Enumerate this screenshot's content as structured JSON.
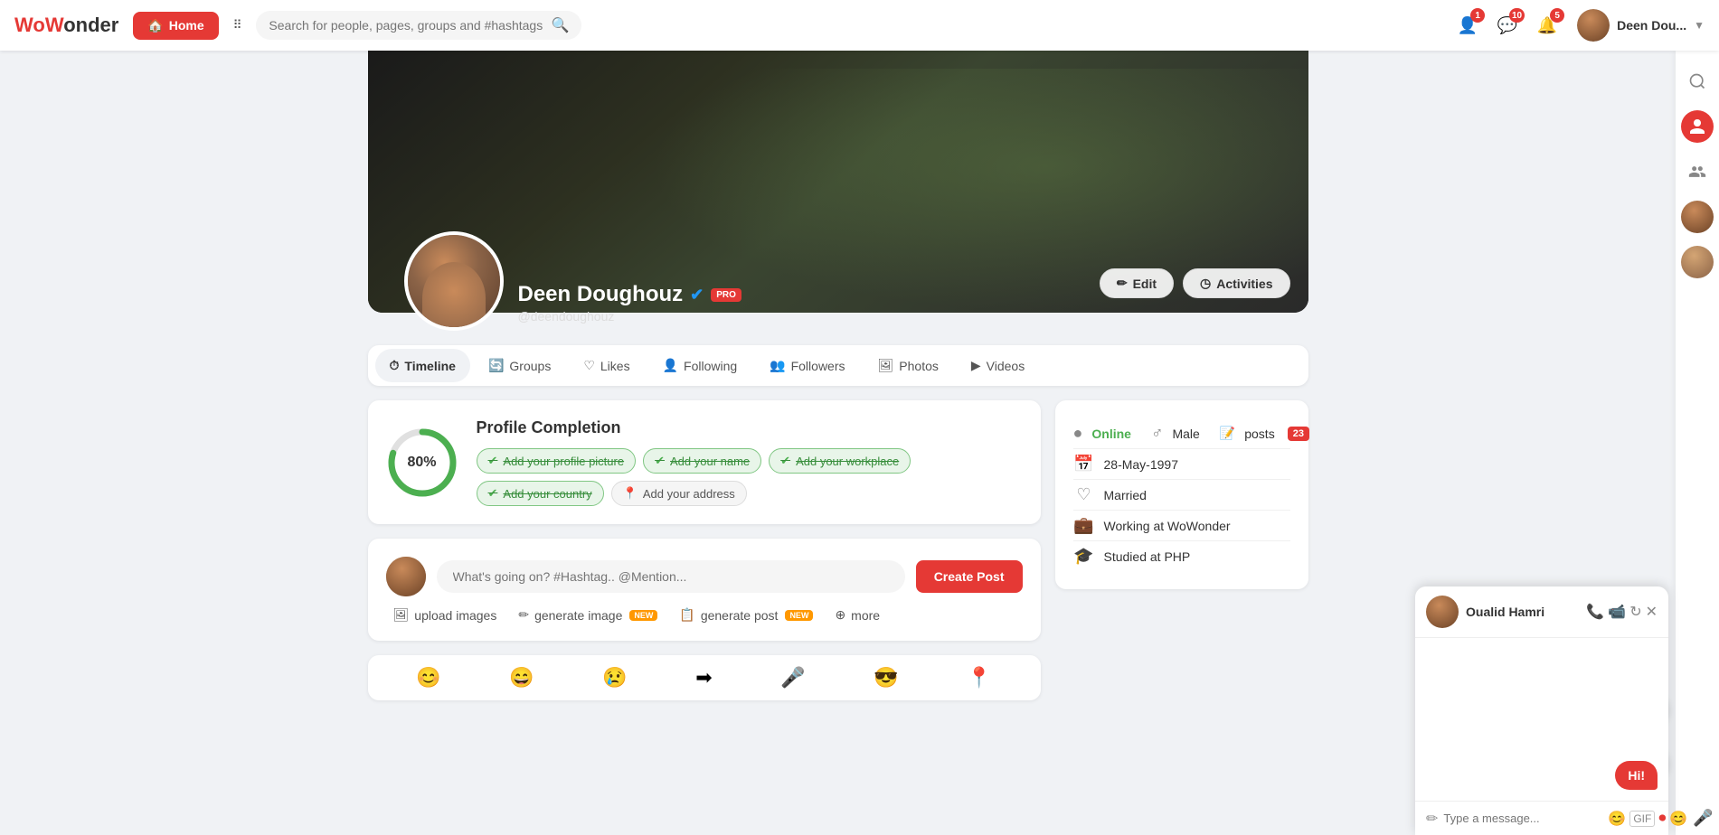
{
  "app": {
    "logo_text": "WoWonder"
  },
  "navbar": {
    "home_label": "Home",
    "search_placeholder": "Search for people, pages, groups and #hashtags",
    "badge_friends": "1",
    "badge_messages": "10",
    "badge_notifications": "5",
    "user_name": "Deen Dou..."
  },
  "profile": {
    "name": "Deen Doughouz",
    "handle": "@deendoughouz",
    "verified": true,
    "pro": "PRO",
    "edit_label": "Edit",
    "activities_label": "Activities"
  },
  "tabs": [
    {
      "id": "timeline",
      "label": "Timeline",
      "icon": "⏱"
    },
    {
      "id": "groups",
      "label": "Groups",
      "icon": "🔄"
    },
    {
      "id": "likes",
      "label": "Likes",
      "icon": "♡"
    },
    {
      "id": "following",
      "label": "Following",
      "icon": "👤"
    },
    {
      "id": "followers",
      "label": "Followers",
      "icon": "👥"
    },
    {
      "id": "photos",
      "label": "Photos",
      "icon": "🖼"
    },
    {
      "id": "videos",
      "label": "Videos",
      "icon": "▶"
    }
  ],
  "completion": {
    "title": "Profile Completion",
    "percent": "80%",
    "percent_num": 80,
    "tags": [
      {
        "label": "Add your profile picture",
        "done": true
      },
      {
        "label": "Add your name",
        "done": true
      },
      {
        "label": "Add your workplace",
        "done": true
      },
      {
        "label": "Add your country",
        "done": true
      },
      {
        "label": "Add your address",
        "done": false
      }
    ]
  },
  "post_box": {
    "placeholder": "What's going on? #Hashtag.. @Mention...",
    "create_btn": "Create Post",
    "actions": [
      {
        "id": "upload",
        "label": "upload images",
        "icon": "🖼",
        "new": false
      },
      {
        "id": "generate_image",
        "label": "generate image",
        "icon": "✏",
        "new": true
      },
      {
        "id": "generate_post",
        "label": "generate post",
        "icon": "📋",
        "new": true
      },
      {
        "id": "more",
        "label": "more",
        "icon": "⊕",
        "new": false
      }
    ]
  },
  "emoji_bar": {
    "emojis": [
      "😊",
      "😄",
      "😢",
      "➡",
      "🎤",
      "😎",
      "📍"
    ]
  },
  "user_info": {
    "status": "Online",
    "gender": "Male",
    "posts_label": "posts",
    "posts_count": "23",
    "birthday": "28-May-1997",
    "relationship": "Married",
    "work": "Working at WoWonder",
    "education": "Studied at PHP"
  },
  "chat": {
    "contact_name": "Oualid Hamri",
    "greeting": "Hi!",
    "input_placeholder": "Type a message..."
  },
  "sidebar_right": {
    "icons": [
      "search",
      "user",
      "users",
      "avatar1",
      "avatar2"
    ]
  }
}
